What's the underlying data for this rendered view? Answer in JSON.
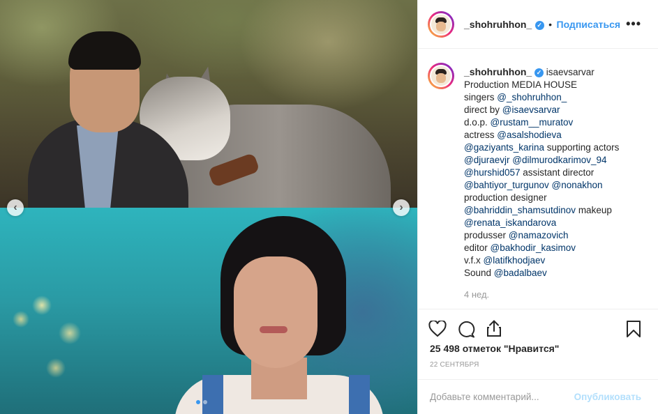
{
  "post": {
    "username": "_shohruhhon_",
    "verified_badge": "✓",
    "follow_label": "Подписаться",
    "more_label": "•••"
  },
  "caption": {
    "author": "_shohruhhon_",
    "tagged": "isaevsarvar",
    "lines": [
      [
        {
          "t": "Production MEDIA HOUSE",
          "m": false
        }
      ],
      [
        {
          "t": "singers ",
          "m": false
        },
        {
          "t": "@_shohruhhon_",
          "m": true
        }
      ],
      [
        {
          "t": "direct by ",
          "m": false
        },
        {
          "t": "@isaevsarvar",
          "m": true
        }
      ],
      [
        {
          "t": "d.o.p. ",
          "m": false
        },
        {
          "t": "@rustam__muratov",
          "m": true
        }
      ],
      [
        {
          "t": "actress ",
          "m": false
        },
        {
          "t": "@asalshodieva",
          "m": true
        }
      ],
      [
        {
          "t": "@gaziyants_karina",
          "m": true
        },
        {
          "t": " supporting actors",
          "m": false
        }
      ],
      [
        {
          "t": "@djuraevjr",
          "m": true
        },
        {
          "t": " ",
          "m": false
        },
        {
          "t": "@dilmurodkarimov_94",
          "m": true
        }
      ],
      [
        {
          "t": "@hurshid057",
          "m": true
        },
        {
          "t": " assistant director",
          "m": false
        }
      ],
      [
        {
          "t": "@bahtiyor_turgunov",
          "m": true
        },
        {
          "t": " ",
          "m": false
        },
        {
          "t": "@nonakhon",
          "m": true
        }
      ],
      [
        {
          "t": "production designer",
          "m": false
        }
      ],
      [
        {
          "t": "@bahriddin_shamsutdinov",
          "m": true
        },
        {
          "t": " makeup",
          "m": false
        }
      ],
      [
        {
          "t": "@renata_iskandarova",
          "m": true
        }
      ],
      [
        {
          "t": "produsser ",
          "m": false
        },
        {
          "t": "@namazovich",
          "m": true
        }
      ],
      [
        {
          "t": "editor ",
          "m": false
        },
        {
          "t": "@bakhodir_kasimov",
          "m": true
        }
      ],
      [
        {
          "t": "v.f.x ",
          "m": false
        },
        {
          "t": "@latifkhodjaev",
          "m": true
        }
      ],
      [
        {
          "t": "Sound ",
          "m": false
        },
        {
          "t": "@badalbaev",
          "m": true
        }
      ]
    ],
    "time_ago": "4 нед."
  },
  "engagement": {
    "likes_text": "25 498 отметок \"Нравится\"",
    "date": "22 СЕНТЯБРЯ"
  },
  "comment": {
    "placeholder": "Добавьте комментарий...",
    "publish_label": "Опубликовать"
  },
  "carousel": {
    "prev_label": "‹",
    "next_label": "›",
    "slides": 2,
    "active_index": 1
  },
  "colors": {
    "accent": "#3897f0",
    "mention": "#003569",
    "muted": "#999999",
    "publish_disabled": "#b2dffc"
  },
  "icons": [
    "heart-icon",
    "comment-icon",
    "share-icon",
    "bookmark-icon",
    "chevron-left-icon",
    "chevron-right-icon"
  ]
}
